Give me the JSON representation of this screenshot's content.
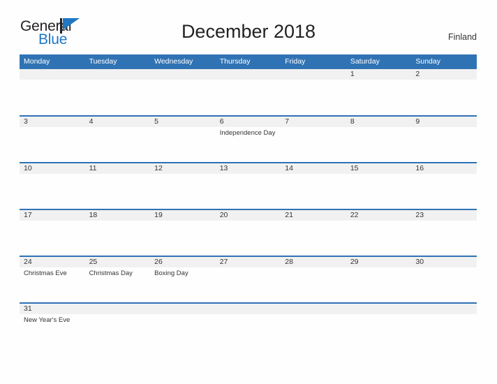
{
  "brand": {
    "name_part1": "General",
    "name_part2": "Blue",
    "flag_icon": "flag-triangle-icon",
    "accent_color": "#1f77c4"
  },
  "header": {
    "title": "December 2018",
    "country": "Finland"
  },
  "theme": {
    "header_blue": "#3073b4",
    "row_divider_blue": "#2f72b5",
    "date_band_gray": "#f1f1f1",
    "page_background": "#fefefe",
    "text_color": "#333333"
  },
  "calendar": {
    "month": "December",
    "year": "2018",
    "weekday_headers": [
      "Monday",
      "Tuesday",
      "Wednesday",
      "Thursday",
      "Friday",
      "Saturday",
      "Sunday"
    ],
    "weeks": [
      [
        {
          "day": "",
          "event": ""
        },
        {
          "day": "",
          "event": ""
        },
        {
          "day": "",
          "event": ""
        },
        {
          "day": "",
          "event": ""
        },
        {
          "day": "",
          "event": ""
        },
        {
          "day": "1",
          "event": ""
        },
        {
          "day": "2",
          "event": ""
        }
      ],
      [
        {
          "day": "3",
          "event": ""
        },
        {
          "day": "4",
          "event": ""
        },
        {
          "day": "5",
          "event": ""
        },
        {
          "day": "6",
          "event": "Independence Day"
        },
        {
          "day": "7",
          "event": ""
        },
        {
          "day": "8",
          "event": ""
        },
        {
          "day": "9",
          "event": ""
        }
      ],
      [
        {
          "day": "10",
          "event": ""
        },
        {
          "day": "11",
          "event": ""
        },
        {
          "day": "12",
          "event": ""
        },
        {
          "day": "13",
          "event": ""
        },
        {
          "day": "14",
          "event": ""
        },
        {
          "day": "15",
          "event": ""
        },
        {
          "day": "16",
          "event": ""
        }
      ],
      [
        {
          "day": "17",
          "event": ""
        },
        {
          "day": "18",
          "event": ""
        },
        {
          "day": "19",
          "event": ""
        },
        {
          "day": "20",
          "event": ""
        },
        {
          "day": "21",
          "event": ""
        },
        {
          "day": "22",
          "event": ""
        },
        {
          "day": "23",
          "event": ""
        }
      ],
      [
        {
          "day": "24",
          "event": "Christmas Eve"
        },
        {
          "day": "25",
          "event": "Christmas Day"
        },
        {
          "day": "26",
          "event": "Boxing Day"
        },
        {
          "day": "27",
          "event": ""
        },
        {
          "day": "28",
          "event": ""
        },
        {
          "day": "29",
          "event": ""
        },
        {
          "day": "30",
          "event": ""
        }
      ],
      [
        {
          "day": "31",
          "event": "New Year's Eve"
        },
        {
          "day": "",
          "event": ""
        },
        {
          "day": "",
          "event": ""
        },
        {
          "day": "",
          "event": ""
        },
        {
          "day": "",
          "event": ""
        },
        {
          "day": "",
          "event": ""
        },
        {
          "day": "",
          "event": ""
        }
      ]
    ]
  }
}
